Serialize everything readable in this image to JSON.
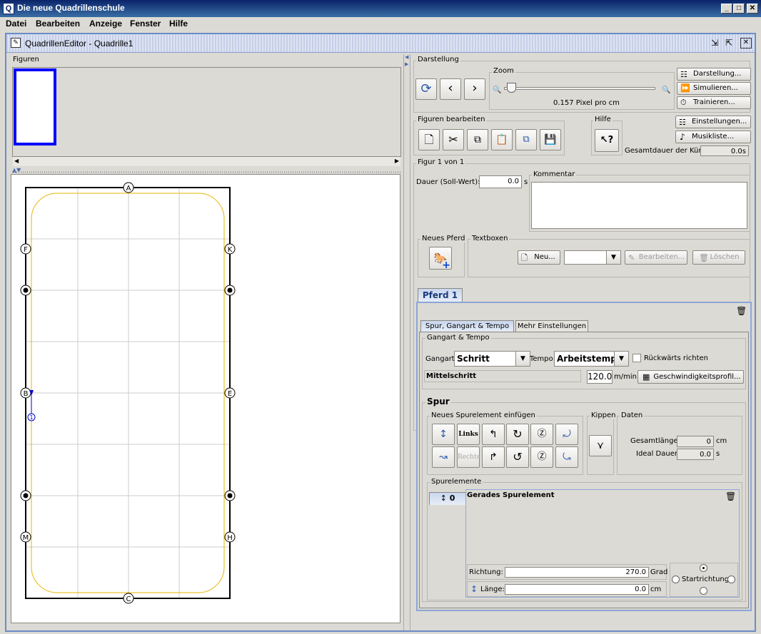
{
  "window": {
    "title": "Die neue Quadrillenschule",
    "app_icon": "Q"
  },
  "menu": [
    "Datei",
    "Bearbeiten",
    "Anzeige",
    "Fenster",
    "Hilfe"
  ],
  "editor": {
    "title": "QuadrillenEditor - Quadrille1"
  },
  "figuren": {
    "label": "Figuren"
  },
  "arena": {
    "letters": {
      "top": "A",
      "bottom": "C",
      "left": [
        "F",
        "B",
        "M"
      ],
      "right": [
        "K",
        "E",
        "H"
      ]
    },
    "horse_number": "1"
  },
  "darstellung": {
    "label": "Darstellung",
    "zoom_label": "Zoom",
    "zoom_value": "0.157 Pixel pro cm",
    "zoom_fraction": 0.02,
    "buttons": {
      "darstellung": "Darstellung...",
      "simulieren": "Simulieren...",
      "trainieren": "Trainieren..."
    }
  },
  "figuren_bearbeiten": {
    "label": "Figuren bearbeiten"
  },
  "hilfe": {
    "label": "Hilfe"
  },
  "settings": {
    "einstellungen": "Einstellungen...",
    "musikliste": "Musikliste..."
  },
  "gesamtdauer": {
    "label": "Gesamtdauer der Kür:",
    "value": "0.0s"
  },
  "figur": {
    "label": "Figur 1 von 1",
    "dauer_label": "Dauer (Soll-Wert):",
    "dauer_value": "0.0",
    "dauer_unit": "s",
    "kommentar_label": "Kommentar"
  },
  "neues_pferd": {
    "label": "Neues Pferd"
  },
  "textboxen": {
    "label": "Textboxen",
    "neu": "Neu...",
    "bearbeiten": "Bearbeiten...",
    "loeschen": "Löschen"
  },
  "pferd_tab": {
    "label": "Pferd 1"
  },
  "subtabs": [
    "Spur, Gangart & Tempo",
    "Mehr Einstellungen"
  ],
  "gangart_tempo": {
    "label": "Gangart & Tempo",
    "gangart_label": "Gangart:",
    "gangart_value": "Schritt",
    "tempo_label": "Tempo:",
    "tempo_value": "Arbeitstempo",
    "rueckwaerts": "Rückwärts richten",
    "mittelschritt": "Mittelschritt",
    "speed": "120.0",
    "speed_unit": "m/min",
    "profil": "Geschwindigkeitsprofil..."
  },
  "spur": {
    "label": "Spur",
    "neues_label": "Neues Spurelement einfügen",
    "links": "Links",
    "rechts": "Rechts",
    "kippen": "Kippen",
    "daten": "Daten",
    "gesamtlaenge_label": "Gesamtlänge:",
    "gesamtlaenge_value": "0",
    "gesamtlaenge_unit": "cm",
    "ideal_label": "Ideal Dauer:",
    "ideal_value": "0.0",
    "ideal_unit": "s"
  },
  "spurelemente": {
    "label": "Spurelemente",
    "tab_value": "0",
    "element_title": "Gerades Spurelement",
    "richtung_label": "Richtung:",
    "richtung_value": "270.0",
    "richtung_unit": "Grad",
    "laenge_label": "Länge:",
    "laenge_value": "0.0",
    "laenge_unit": "cm",
    "startrichtung": "Startrichtung"
  },
  "colors": {
    "title_bar": "#0a246a",
    "selection": "#0000ff",
    "arena_track": "#e8b400",
    "horse": "#c41e1e"
  }
}
